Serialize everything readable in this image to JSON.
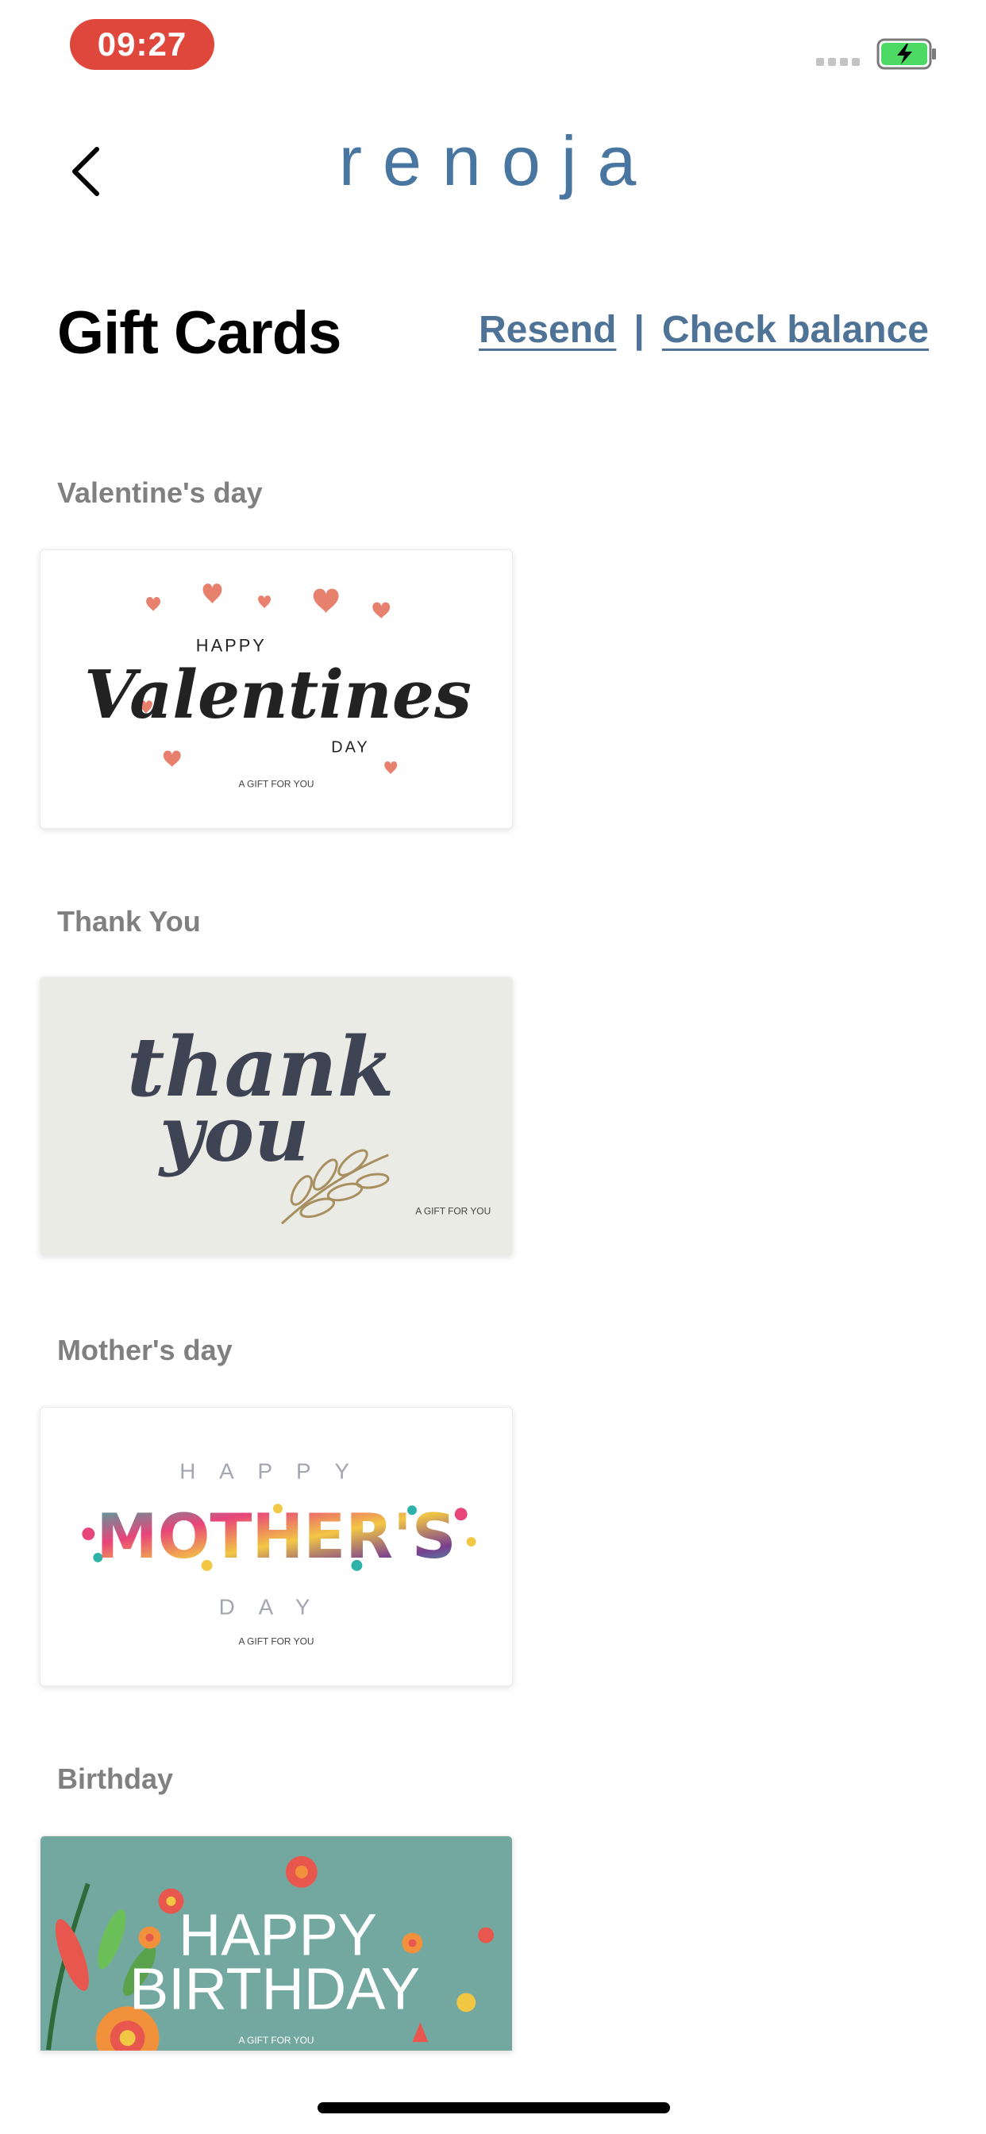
{
  "status_bar": {
    "time": "09:27"
  },
  "header": {
    "logo_text": "renoja"
  },
  "page": {
    "title": "Gift Cards",
    "resend_label": "Resend",
    "separator": "|",
    "check_balance_label": "Check balance"
  },
  "sections": [
    {
      "label": "Valentine's day",
      "card_text": {
        "top": "HAPPY",
        "script": "Valentines",
        "bottom": "DAY",
        "caption": "A GIFT FOR YOU"
      }
    },
    {
      "label": "Thank You",
      "card_text": {
        "line1": "thank",
        "line2": "you",
        "caption": "A GIFT FOR YOU"
      }
    },
    {
      "label": "Mother's day",
      "card_text": {
        "top": "HAPPY",
        "main": "MOTHER'S",
        "bottom": "DAY",
        "caption": "A GIFT FOR YOU"
      }
    },
    {
      "label": "Birthday",
      "card_text": {
        "line1": "HAPPY",
        "line2": "BIRTHDAY",
        "caption": "A GIFT FOR YOU"
      }
    }
  ],
  "colors": {
    "accent": "#4876a0",
    "link": "#4f7397",
    "time_badge": "#e0473c",
    "battery": "#4cd964",
    "heart": "#e8806e",
    "thankyou_bg": "#ebebe6",
    "birthday_bg": "#73a8a0"
  }
}
